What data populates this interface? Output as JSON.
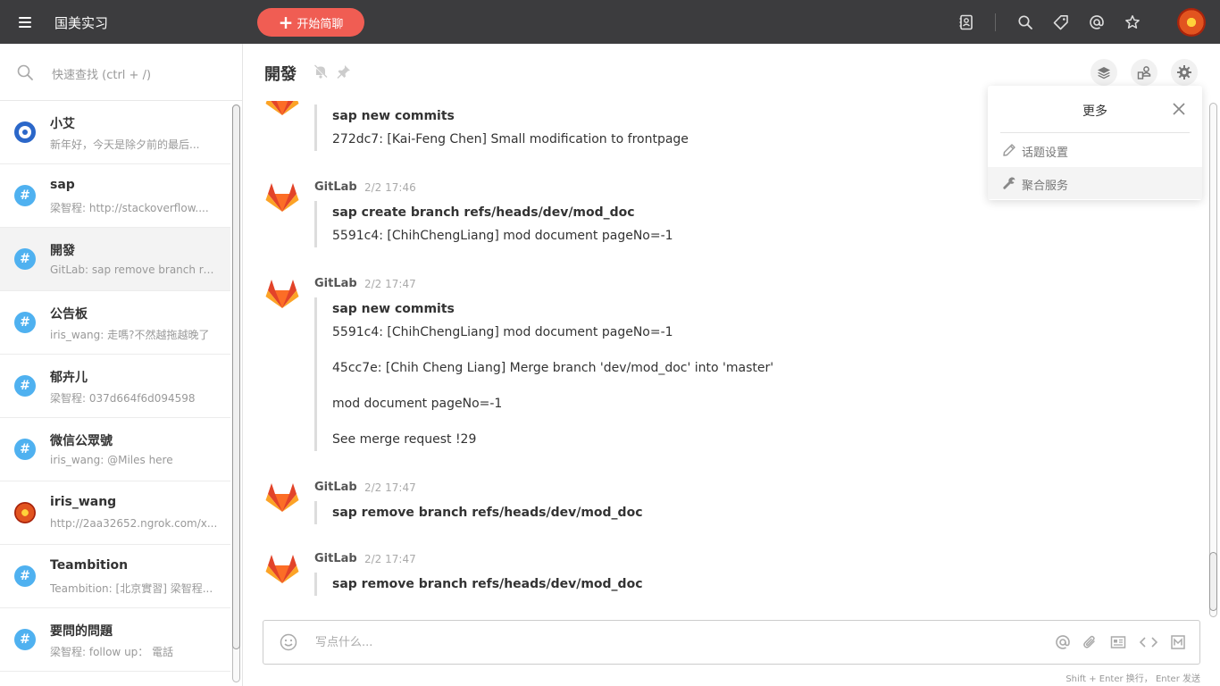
{
  "topbar": {
    "team_name": "国美实习",
    "start_chat_label": "开始简聊"
  },
  "sidebar": {
    "search_placeholder": "快速查找 (ctrl + /)",
    "conversations": [
      {
        "name": "小艾",
        "preview": "新年好，今天是除夕前的最后...",
        "icon": "robot-avatar"
      },
      {
        "name": "sap",
        "preview": "梁智程: http://stackoverflow....",
        "icon": "hash-icon"
      },
      {
        "name": "開發",
        "preview": "GitLab: sap remove branch re...",
        "icon": "hash-icon"
      },
      {
        "name": "公告板",
        "preview": "iris_wang: 走嗎?不然越拖越晚了",
        "icon": "hash-icon"
      },
      {
        "name": "郁卉儿",
        "preview": "梁智程: 037d664f6d094598",
        "icon": "hash-icon"
      },
      {
        "name": "微信公眾號",
        "preview": "iris_wang: @Miles here",
        "icon": "hash-icon"
      },
      {
        "name": "iris_wang",
        "preview": "http://2aa32652.ngrok.com/x...",
        "icon": "user-avatar"
      },
      {
        "name": "Teambition",
        "preview": "Teambition: [北京實習] 梁智程...",
        "icon": "hash-icon"
      },
      {
        "name": "要問的問題",
        "preview": "梁智程: follow up： 電話",
        "icon": "hash-icon"
      }
    ]
  },
  "header": {
    "title": "開發"
  },
  "messages": [
    {
      "author": "",
      "time": "",
      "quote_title": "sap new commits",
      "lines": [
        "272dc7: [Kai-Feng Chen] Small modification to frontpage"
      ]
    },
    {
      "author": "GitLab",
      "time": "2/2 17:46",
      "quote_title": "sap create branch refs/heads/dev/mod_doc",
      "lines": [
        "5591c4: [ChihChengLiang] mod document pageNo=-1"
      ]
    },
    {
      "author": "GitLab",
      "time": "2/2 17:47",
      "quote_title": "sap new commits",
      "lines": [
        "5591c4: [ChihChengLiang] mod document pageNo=-1",
        "45cc7e: [Chih Cheng Liang] Merge branch 'dev/mod_doc' into 'master'",
        "mod document pageNo=-1",
        "See merge request !29"
      ]
    },
    {
      "author": "GitLab",
      "time": "2/2 17:47",
      "quote_title": "sap remove branch refs/heads/dev/mod_doc",
      "lines": []
    },
    {
      "author": "GitLab",
      "time": "2/2 17:47",
      "quote_title": "sap remove branch refs/heads/dev/mod_doc",
      "lines": []
    }
  ],
  "composer": {
    "placeholder": "写点什么...",
    "hint": "Shift + Enter 换行， Enter 发送"
  },
  "more_panel": {
    "title": "更多",
    "items": [
      {
        "label": "话题设置",
        "icon": "pencil-icon"
      },
      {
        "label": "聚合服务",
        "icon": "wrench-icon"
      }
    ]
  },
  "colors": {
    "topbar": "#3c3c3e",
    "accent": "#f05d53",
    "channel": "#4fb1f0"
  }
}
